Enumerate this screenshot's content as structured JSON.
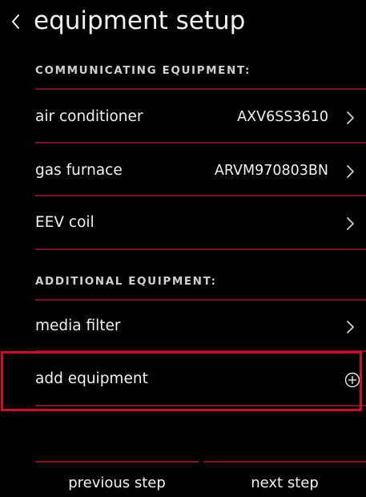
{
  "header": {
    "back_icon": "chevron-left-icon",
    "title": "equipment setup"
  },
  "sections": {
    "communicating": {
      "label": "COMMUNICATING EQUIPMENT:",
      "items": [
        {
          "label": "air conditioner",
          "value": "AXV6SS3610",
          "icon": "chevron-right-icon"
        },
        {
          "label": "gas furnace",
          "value": "ARVM970803BN",
          "icon": "chevron-right-icon"
        },
        {
          "label": "EEV coil",
          "value": "",
          "icon": "chevron-right-icon"
        }
      ]
    },
    "additional": {
      "label": "ADDITIONAL EQUIPMENT:",
      "items": [
        {
          "label": "media filter",
          "value": "",
          "icon": "chevron-right-icon"
        },
        {
          "label": "add equipment",
          "value": "",
          "icon": "plus-circle-icon"
        }
      ]
    }
  },
  "footer": {
    "previous_label": "previous step",
    "next_label": "next step"
  },
  "colors": {
    "background": "#000000",
    "text": "#f2f2f2",
    "divider": "#7a1624",
    "highlight": "#c8102e"
  }
}
